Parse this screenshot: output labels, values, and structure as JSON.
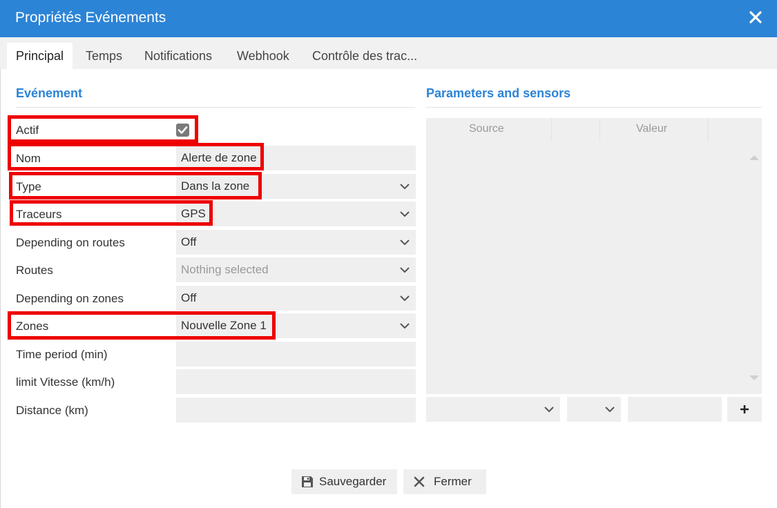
{
  "window": {
    "title": "Propriétés Evénements"
  },
  "tabs": [
    {
      "label": "Principal",
      "active": true
    },
    {
      "label": "Temps",
      "active": false
    },
    {
      "label": "Notifications",
      "active": false
    },
    {
      "label": "Webhook",
      "active": false
    },
    {
      "label": "Contrôle des trac...",
      "active": false
    }
  ],
  "event_section": {
    "title": "Evénement",
    "fields": {
      "active": {
        "label": "Actif",
        "checked": true
      },
      "name": {
        "label": "Nom",
        "value": "Alerte de zone"
      },
      "type": {
        "label": "Type",
        "value": "Dans la zone"
      },
      "trackers": {
        "label": "Traceurs",
        "value": "GPS"
      },
      "depending_routes": {
        "label": "Depending on routes",
        "value": "Off"
      },
      "routes": {
        "label": "Routes",
        "placeholder": "Nothing selected"
      },
      "depending_zones": {
        "label": "Depending on zones",
        "value": "Off"
      },
      "zones": {
        "label": "Zones",
        "value": "Nouvelle Zone 1"
      },
      "time_period": {
        "label": "Time period (min)",
        "value": ""
      },
      "speed_limit": {
        "label": "limit Vitesse (km/h)",
        "value": ""
      },
      "distance": {
        "label": "Distance (km)",
        "value": ""
      }
    }
  },
  "sensors_section": {
    "title": "Parameters and sensors",
    "columns": [
      "Source",
      "Valeur"
    ],
    "rows": []
  },
  "buttons": {
    "save": "Sauvegarder",
    "close": "Fermer"
  },
  "colors": {
    "accent": "#2c84d6",
    "highlight": "#ee0000",
    "field_bg": "#efefef"
  }
}
